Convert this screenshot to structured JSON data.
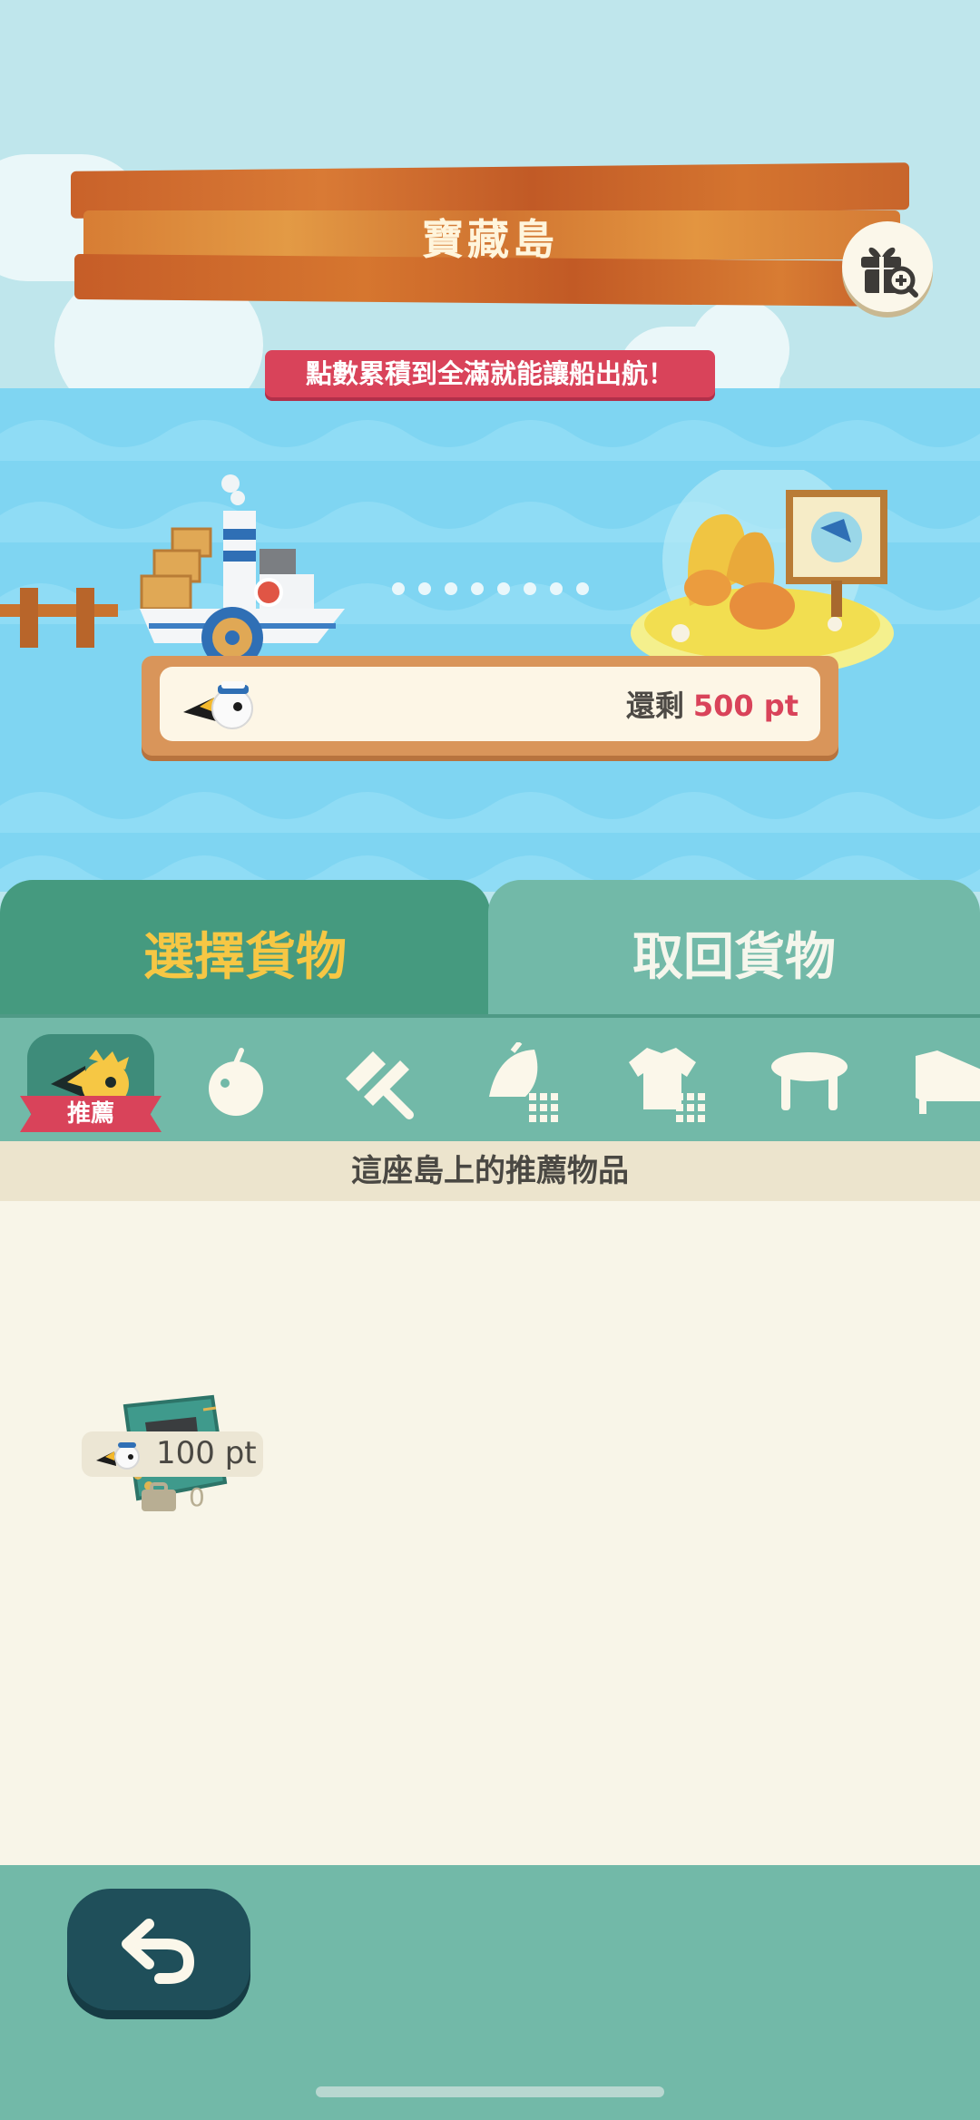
{
  "island": {
    "name": "寶藏島"
  },
  "status": {
    "remaining_label": "還剩",
    "remaining_points": "500 pt",
    "tip": "點數累積到全滿就能讓船出航！"
  },
  "tabs": [
    {
      "label": "選擇貨物",
      "active": true
    },
    {
      "label": "取回貨物",
      "active": false
    }
  ],
  "categories": {
    "recommended_label": "推薦",
    "icons": [
      "recommended-icon",
      "fruit-icon",
      "tools-icon",
      "materials-icon",
      "clothing-icon",
      "furniture-stool-icon",
      "furniture-bed-icon"
    ]
  },
  "section": {
    "title": "這座島上的推薦物品"
  },
  "items": [
    {
      "icon": "circuit-board-icon",
      "price": "100 pt",
      "stock": "0"
    }
  ],
  "colors": {
    "accent_red": "#d9435a",
    "tab_active": "#459a7f",
    "tab_inactive": "#72b9a8",
    "tab_active_text": "#f6c744",
    "back_button": "#1f4f5a"
  }
}
